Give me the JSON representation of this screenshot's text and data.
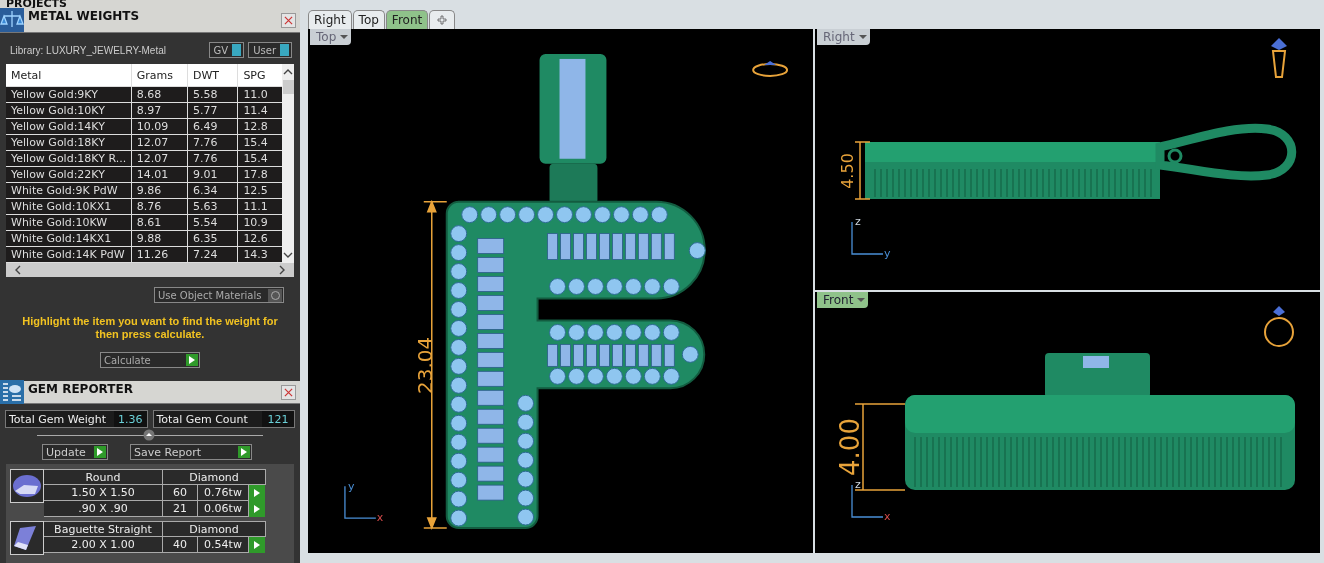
{
  "projects_panel": {
    "title": "PROJECTS"
  },
  "metal_weights": {
    "title": "METAL WEIGHTS",
    "library": "Library: LUXURY_JEWELRY-Metal",
    "toggles": [
      {
        "label": "GV",
        "on": true
      },
      {
        "label": "User",
        "on": true
      }
    ],
    "columns": [
      "Metal",
      "Grams",
      "DWT",
      "SPG"
    ],
    "rows": [
      [
        "Yellow Gold:9KY",
        "8.68",
        "5.58",
        "11.0"
      ],
      [
        "Yellow Gold:10KY",
        "8.97",
        "5.77",
        "11.4"
      ],
      [
        "Yellow Gold:14KY",
        "10.09",
        "6.49",
        "12.8"
      ],
      [
        "Yellow Gold:18KY",
        "12.07",
        "7.76",
        "15.4"
      ],
      [
        "Yellow Gold:18KY R...",
        "12.07",
        "7.76",
        "15.4"
      ],
      [
        "Yellow Gold:22KY",
        "14.01",
        "9.01",
        "17.8"
      ],
      [
        "White Gold:9K PdW",
        "9.86",
        "6.34",
        "12.5"
      ],
      [
        "White Gold:10KX1",
        "8.76",
        "5.63",
        "11.1"
      ],
      [
        "White Gold:10KW",
        "8.61",
        "5.54",
        "10.9"
      ],
      [
        "White Gold:14KX1",
        "9.88",
        "6.35",
        "12.6"
      ],
      [
        "White Gold:14K PdW",
        "11.26",
        "7.24",
        "14.3"
      ]
    ],
    "use_object_materials": {
      "label": "Use Object Materials",
      "checked": false
    },
    "message": "Highlight the item you want to find the weight for then press calculate.",
    "calculate_button": "Calculate"
  },
  "gem_reporter": {
    "title": "GEM REPORTER",
    "total_weight": {
      "label": "Total Gem Weight",
      "value": "1.36"
    },
    "total_count": {
      "label": "Total Gem Count",
      "value": "121"
    },
    "buttons": [
      "Update",
      "Save Report"
    ],
    "groups": [
      {
        "kind": "round",
        "shape": "Round",
        "material": "Diamond",
        "rows": [
          {
            "size": "1.50 X 1.50",
            "count": "60",
            "weight": "0.76tw"
          },
          {
            "size": ".90 X .90",
            "count": "21",
            "weight": "0.06tw"
          }
        ]
      },
      {
        "kind": "baguette",
        "shape": "Baguette Straight",
        "material": "Diamond",
        "rows": [
          {
            "size": "2.00 X 1.00",
            "count": "40",
            "weight": "0.54tw"
          }
        ]
      }
    ]
  },
  "tabs": [
    {
      "label": "Right",
      "selected": false
    },
    {
      "label": "Top",
      "selected": false
    },
    {
      "label": "Front",
      "selected": true
    }
  ],
  "viewports": [
    {
      "kind": "top",
      "label": "Top",
      "dimension": "23.04",
      "axes": [
        "y",
        "x"
      ]
    },
    {
      "kind": "right",
      "label": "Right",
      "dimension": "4.50",
      "axes": [
        "z",
        "y"
      ]
    },
    {
      "kind": "front",
      "label": "Front",
      "dimension": "4.00",
      "axes": [
        "z",
        "x"
      ]
    }
  ]
}
